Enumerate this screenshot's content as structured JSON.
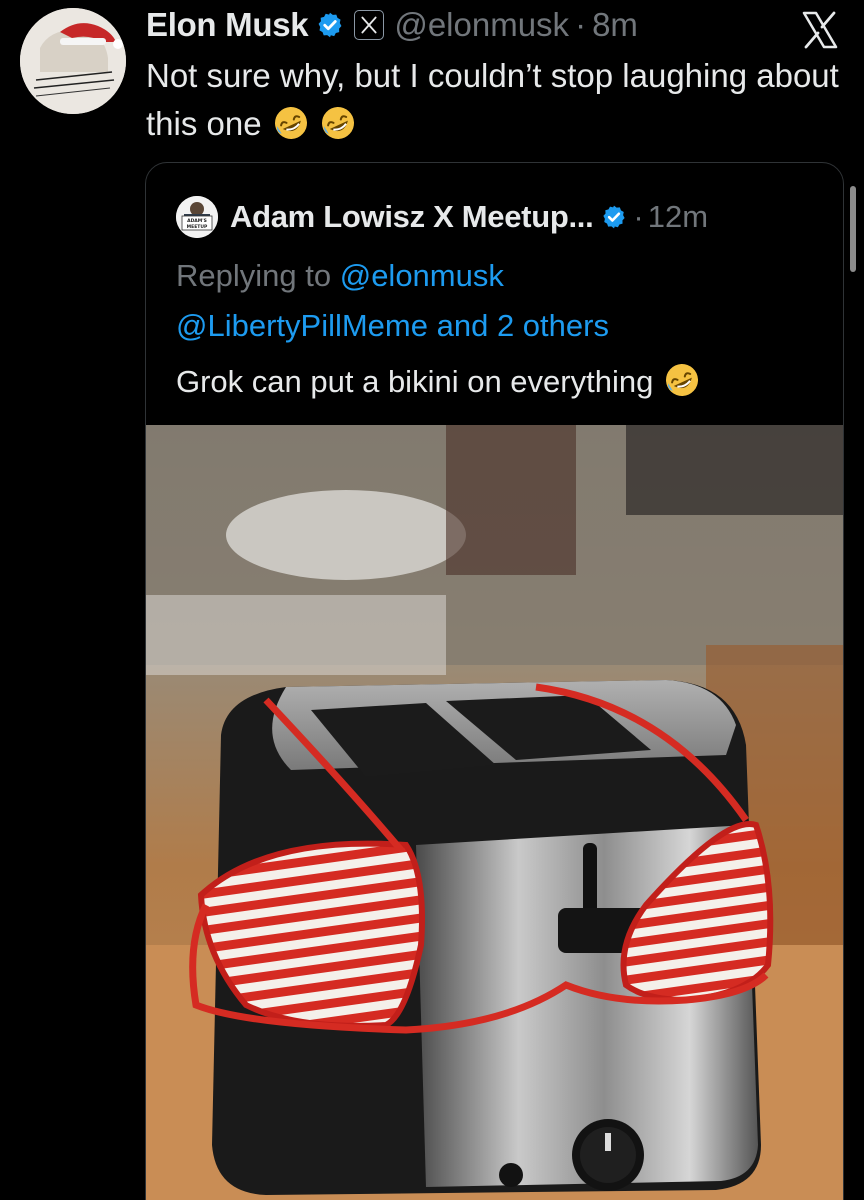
{
  "tweet": {
    "author_name": "Elon Musk",
    "handle": "@elonmusk",
    "separator": "·",
    "time": "8m",
    "text": "Not sure why, but I couldn’t stop laughing about this one",
    "emoji": [
      "rolling-on-floor-laughing",
      "rolling-on-floor-laughing"
    ]
  },
  "quoted_tweet": {
    "author_name": "Adam Lowisz X Meetup...",
    "separator": "·",
    "time": "12m",
    "replying_prefix": "Replying to",
    "replying_mentions": [
      "@elonmusk",
      "@LibertyPillMeme"
    ],
    "replying_suffix": "and 2 others",
    "text": "Grok can put a bikini on everything",
    "emoji": [
      "rolling-on-floor-laughing"
    ]
  },
  "icons": {
    "verified": "verified-badge-icon",
    "affiliation": "x-affiliation-icon",
    "brand": "x-logo-icon"
  },
  "colors": {
    "background": "#000000",
    "text_primary": "#e7e9ea",
    "text_secondary": "#71767b",
    "link": "#1d9bf0",
    "verified": "#1d9bf0",
    "card_border": "#2f3336"
  }
}
